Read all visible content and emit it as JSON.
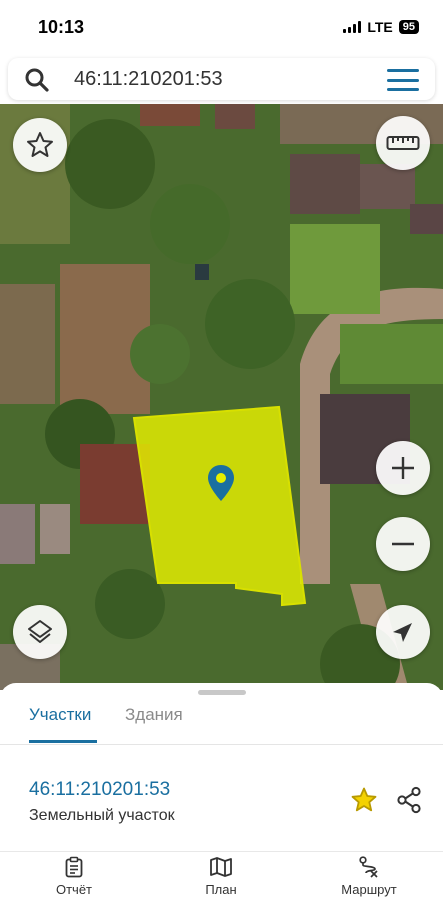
{
  "status_bar": {
    "time": "10:13",
    "network": "LTE",
    "battery": "95"
  },
  "search": {
    "query": "46:11:210201:53",
    "icon": "search-icon",
    "menu_icon": "menu-icon"
  },
  "map_controls": {
    "favorite_icon": "star-icon",
    "ruler_icon": "ruler-icon",
    "zoom_in_icon": "plus-icon",
    "zoom_out_icon": "minus-icon",
    "layers_icon": "layers-icon",
    "locate_icon": "navigation-arrow-icon"
  },
  "colors": {
    "accent": "#1a6fa0",
    "parcel_fill": "#e6f000",
    "parcel_stroke": "#d8e000",
    "star": "#e0b800"
  },
  "sheet": {
    "tabs": [
      {
        "label": "Участки",
        "active": true
      },
      {
        "label": "Здания",
        "active": false
      }
    ],
    "parcel": {
      "id": "46:11:210201:53",
      "type": "Земельный участок"
    }
  },
  "bottom_nav": [
    {
      "label": "Отчёт",
      "icon": "clipboard-icon"
    },
    {
      "label": "План",
      "icon": "map-icon"
    },
    {
      "label": "Маршрут",
      "icon": "route-icon"
    }
  ]
}
